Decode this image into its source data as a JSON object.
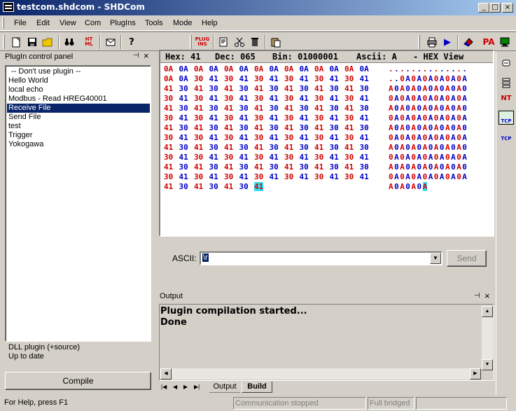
{
  "window": {
    "title": "testcom.shdcom - SHDCom"
  },
  "caption_buttons": {
    "minimize": "_",
    "maximize": "□",
    "close": "×"
  },
  "menu": [
    "File",
    "Edit",
    "View",
    "Com",
    "PlugIns",
    "Tools",
    "Mode",
    "Help"
  ],
  "toolbar": {
    "plugins_label": "PLUG INS",
    "html_label": "HT ML",
    "pa_label": "PA"
  },
  "plugin_panel": {
    "title": "PlugIn control panel",
    "items": [
      "-- Don't use plugin --",
      "Hello World",
      "local echo",
      "Modbus - Read HREG40001",
      "Receive File",
      "Send File",
      "test",
      "Trigger",
      "Yokogawa"
    ],
    "selected_index": 4,
    "info_line1": "DLL plugin (+source)",
    "info_line2": "Up to date",
    "compile_label": "Compile"
  },
  "hex_view": {
    "hex_label": "Hex: 41",
    "dec_label": "Dec: 065",
    "bin_label": "Bin: 01000001",
    "ascii_label": "Ascii: A",
    "mode_label": "- HEX View",
    "rows": [
      {
        "hex": "0A 0A 0A 0A 0A 0A 0A 0A 0A 0A 0A 0A 0A 0A",
        "ascii": ".............."
      },
      {
        "hex": "0A 0A 30 41 30 41 30 41 30 41 30 41 30 41",
        "ascii": "..0A0A0A0A0A0A"
      },
      {
        "hex": "41 30 41 30 41 30 41 30 41 30 41 30 41 30",
        "ascii": "A0A0A0A0A0A0A0"
      },
      {
        "hex": "30 41 30 41 30 41 30 41 30 41 30 41 30 41",
        "ascii": "0A0A0A0A0A0A0A"
      },
      {
        "hex": "41 30 41 30 41 30 41 30 41 30 41 30 41 30",
        "ascii": "A0A0A0A0A0A0A0"
      },
      {
        "hex": "30 41 30 41 30 41 30 41 30 41 30 41 30 41",
        "ascii": "0A0A0A0A0A0A0A"
      },
      {
        "hex": "41 30 41 30 41 30 41 30 41 30 41 30 41 30",
        "ascii": "A0A0A0A0A0A0A0"
      },
      {
        "hex": "30 41 30 41 30 41 30 41 30 41 30 41 30 41",
        "ascii": "0A0A0A0A0A0A0A"
      },
      {
        "hex": "41 30 41 30 41 30 41 30 41 30 41 30 41 30",
        "ascii": "A0A0A0A0A0A0A0"
      },
      {
        "hex": "30 41 30 41 30 41 30 41 30 41 30 41 30 41",
        "ascii": "0A0A0A0A0A0A0A"
      },
      {
        "hex": "41 30 41 30 41 30 41 30 41 30 41 30 41 30",
        "ascii": "A0A0A0A0A0A0A0"
      },
      {
        "hex": "30 41 30 41 30 41 30 41 30 41 30 41 30 41",
        "ascii": "0A0A0A0A0A0A0A"
      },
      {
        "hex": "41 30 41 30 41 30 41",
        "ascii": "A0A0A0A"
      }
    ],
    "colors": {
      "red": "#d40000",
      "blue": "#0000c8",
      "highlight": "#33e0f0"
    }
  },
  "ascii_send": {
    "label": "ASCII:",
    "value": "\\r",
    "send_label": "Send"
  },
  "output": {
    "title": "Output",
    "lines": [
      "Plugin compilation started...",
      "Done"
    ],
    "tabs": [
      "Output",
      "Build"
    ],
    "active_tab": 1
  },
  "right_bar": {
    "nt_label": "NT",
    "tcp_label": "TCP"
  },
  "status": {
    "help": "For Help, press F1",
    "comm": "Communication stopped",
    "mode": "Full bridged",
    "extra": ""
  }
}
